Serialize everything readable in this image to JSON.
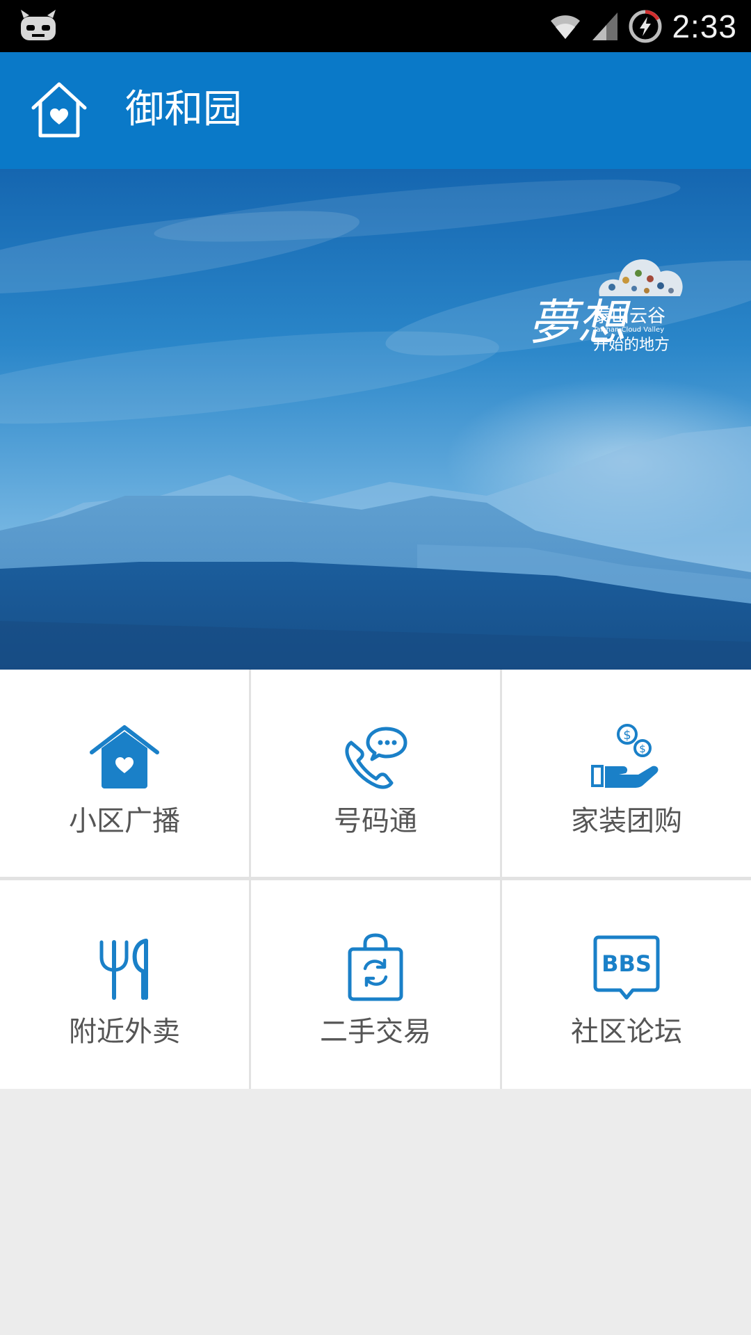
{
  "status_bar": {
    "time": "2:33"
  },
  "header": {
    "title": "御和园",
    "home_icon": "home-heart-icon"
  },
  "banner": {
    "logo_calligraphy": "夢想",
    "logo_name_cn": "泰山云谷",
    "logo_name_en": "Taishan Cloud Valley",
    "logo_slogan": "开始的地方"
  },
  "grid": {
    "items": [
      {
        "label": "小区广播",
        "icon": "house-heart-icon"
      },
      {
        "label": "号码通",
        "icon": "phone-chat-icon"
      },
      {
        "label": "家装团购",
        "icon": "hand-coins-icon"
      },
      {
        "label": "附近外卖",
        "icon": "fork-knife-icon"
      },
      {
        "label": "二手交易",
        "icon": "exchange-bag-icon"
      },
      {
        "label": "社区论坛",
        "icon": "bbs-icon"
      }
    ]
  },
  "colors": {
    "primary": "#0a79c8",
    "icon_blue": "#1a80c8",
    "label_gray": "#555555",
    "background": "#ececec"
  }
}
